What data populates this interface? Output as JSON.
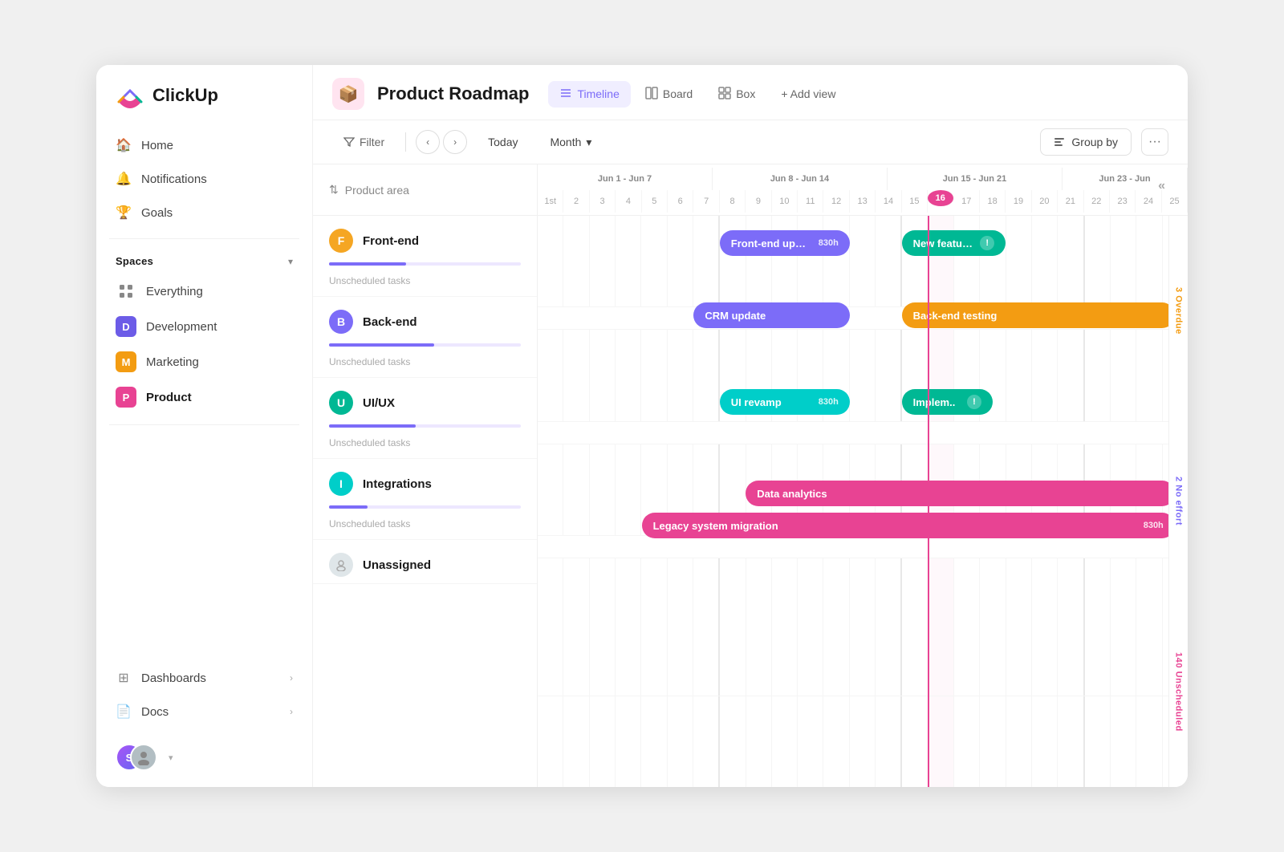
{
  "app": {
    "logo_text": "ClickUp"
  },
  "sidebar": {
    "nav": [
      {
        "id": "home",
        "label": "Home",
        "icon": "🏠"
      },
      {
        "id": "notifications",
        "label": "Notifications",
        "icon": "🔔"
      },
      {
        "id": "goals",
        "label": "Goals",
        "icon": "🏆"
      }
    ],
    "spaces_label": "Spaces",
    "spaces": [
      {
        "id": "everything",
        "label": "Everything",
        "initial": "",
        "type": "grid"
      },
      {
        "id": "development",
        "label": "Development",
        "initial": "D",
        "color": "#6c5ce7"
      },
      {
        "id": "marketing",
        "label": "Marketing",
        "initial": "M",
        "color": "#f39c12"
      },
      {
        "id": "product",
        "label": "Product",
        "initial": "P",
        "color": "#e84393",
        "active": true
      }
    ],
    "bottom_nav": [
      {
        "id": "dashboards",
        "label": "Dashboards",
        "has_arrow": true
      },
      {
        "id": "docs",
        "label": "Docs",
        "has_arrow": true
      }
    ],
    "user_initials": "S"
  },
  "header": {
    "project_icon": "📦",
    "project_title": "Product Roadmap",
    "views": [
      {
        "id": "timeline",
        "label": "Timeline",
        "icon": "≡",
        "active": true
      },
      {
        "id": "board",
        "label": "Board",
        "icon": "⊞"
      },
      {
        "id": "box",
        "label": "Box",
        "icon": "⊡"
      }
    ],
    "add_view_label": "+ Add view"
  },
  "toolbar": {
    "filter_label": "Filter",
    "today_label": "Today",
    "month_label": "Month",
    "group_by_label": "Group by",
    "more_icon": "•••"
  },
  "timeline": {
    "group_column_label": "Product area",
    "week_ranges": [
      {
        "label": "Jun 1 - Jun 7",
        "days": [
          "1st",
          "2",
          "3",
          "4",
          "5",
          "6",
          "7"
        ]
      },
      {
        "label": "Jun 8 - Jun 14",
        "days": [
          "8",
          "9",
          "10",
          "11",
          "12",
          "13",
          "14"
        ]
      },
      {
        "label": "Jun 15 - Jun 21",
        "days": [
          "15",
          "16",
          "17",
          "18",
          "19",
          "20",
          "21"
        ]
      },
      {
        "label": "Jun 23 - Jun",
        "days": [
          "23",
          "22",
          "24",
          "25"
        ]
      }
    ],
    "today_col": 16,
    "rows": [
      {
        "id": "frontend",
        "label": "Front-end",
        "initial": "F",
        "color": "#f5a623",
        "progress": 40,
        "bars": [
          {
            "label": "Front-end upgrade",
            "hours": "830h",
            "color": "#7c6cf8",
            "left_pct": 28,
            "width_pct": 18
          },
          {
            "label": "New feature..",
            "hours": "",
            "color": "#00b894",
            "left_pct": 52,
            "width_pct": 15,
            "warn": true
          }
        ]
      },
      {
        "id": "backend",
        "label": "Back-end",
        "initial": "B",
        "color": "#7c6cf8",
        "progress": 55,
        "bars": [
          {
            "label": "CRM update",
            "hours": "",
            "color": "#7c6cf8",
            "left_pct": 25,
            "width_pct": 22
          },
          {
            "label": "Back-end testing",
            "hours": "",
            "color": "#f39c12",
            "left_pct": 52,
            "width_pct": 42
          }
        ]
      },
      {
        "id": "uiux",
        "label": "UI/UX",
        "initial": "U",
        "color": "#00b894",
        "progress": 45,
        "bars": [
          {
            "label": "UI revamp",
            "hours": "830h",
            "color": "#00cec9",
            "left_pct": 28,
            "width_pct": 18
          },
          {
            "label": "Implem..",
            "hours": "",
            "color": "#00b894",
            "left_pct": 52,
            "width_pct": 14,
            "warn": true
          }
        ]
      },
      {
        "id": "integrations",
        "label": "Integrations",
        "initial": "I",
        "color": "#00cec9",
        "progress": 20,
        "bars": [
          {
            "label": "Data analytics",
            "hours": "",
            "color": "#e84393",
            "left_pct": 33,
            "width_pct": 62
          },
          {
            "label": "Legacy system migration",
            "hours": "830h",
            "color": "#e84393",
            "left_pct": 18,
            "width_pct": 77
          }
        ]
      },
      {
        "id": "unassigned",
        "label": "Unassigned",
        "initial": "?",
        "color": "#dfe6e9",
        "progress": 0,
        "bars": []
      }
    ],
    "side_labels": [
      {
        "id": "overdue",
        "text": "3 Overdue",
        "color": "#f39c12"
      },
      {
        "id": "no-effort",
        "text": "2 No effort",
        "color": "#7c6cf8"
      },
      {
        "id": "unscheduled",
        "text": "140 Unscheduled",
        "color": "#e84393"
      }
    ],
    "unscheduled_label": "Unscheduled tasks"
  }
}
